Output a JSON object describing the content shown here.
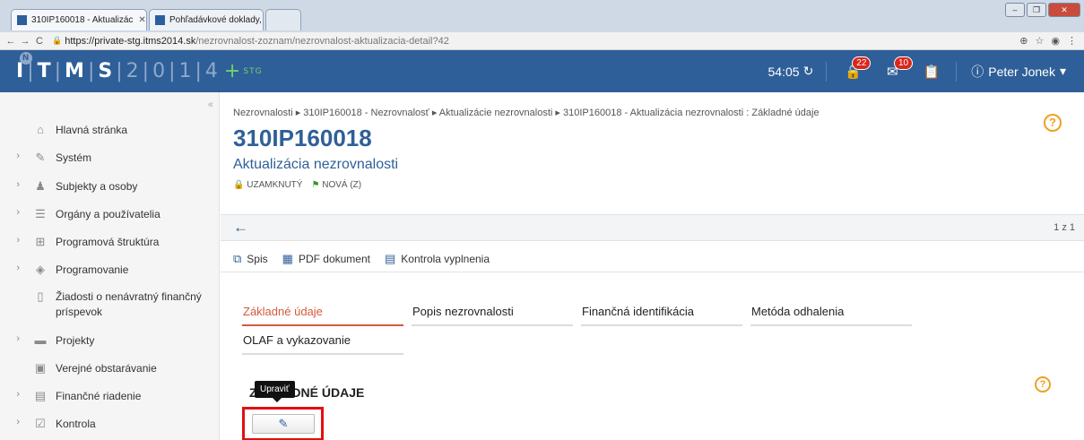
{
  "browser": {
    "tabs": [
      {
        "label": "310IP160018 - Aktualizác"
      },
      {
        "label": "Pohľadávkové doklady, I"
      }
    ],
    "url_host": "https://private-stg.itms2014.sk",
    "url_path": "/nezrovnalost-zoznam/nezrovnalost-aktualizacia-detail?42"
  },
  "header": {
    "logo": {
      "l1": "I",
      "l2": "T",
      "l3": "M",
      "l4": "S",
      "n1": "2",
      "n2": "0",
      "n3": "1",
      "n4": "4",
      "plus": "+",
      "env": "STG"
    },
    "timer": "54:05",
    "lock_badge": "22",
    "mail_badge": "10",
    "user": "Peter Jonek"
  },
  "sidebar": {
    "items": [
      {
        "label": "Hlavná stránka"
      },
      {
        "label": "Systém"
      },
      {
        "label": "Subjekty a osoby"
      },
      {
        "label": "Orgány a používatelia"
      },
      {
        "label": "Programová štruktúra"
      },
      {
        "label": "Programovanie"
      },
      {
        "label": "Žiadosti o nenávratný finančný príspevok"
      },
      {
        "label": "Projekty"
      },
      {
        "label": "Verejné obstarávanie"
      },
      {
        "label": "Finančné riadenie"
      },
      {
        "label": "Kontrola"
      }
    ]
  },
  "main": {
    "breadcrumb": "Nezrovnalosti ▸ 310IP160018 - Nezrovnalosť ▸ Aktualizácie nezrovnalosti ▸ 310IP160018 - Aktualizácia nezrovnalosti : Základné údaje",
    "title": "310IP160018",
    "subtitle": "Aktualizácia nezrovnalosti",
    "status_locked": "UZAMKNUTÝ",
    "status_new": "NOVÁ (Z)",
    "back": "←",
    "pager": "1 z 1",
    "toolbar": {
      "spis": "Spis",
      "pdf": "PDF dokument",
      "kontrola": "Kontrola vyplnenia"
    },
    "tabs": [
      {
        "label": "Základné údaje"
      },
      {
        "label": "Popis nezrovnalosti"
      },
      {
        "label": "Finančná identifikácia"
      },
      {
        "label": "Metóda odhalenia"
      },
      {
        "label": "OLAF a vykazovanie"
      }
    ],
    "section_title": "ZÁKLADNÉ ÚDAJE",
    "tooltip": "Upraviť",
    "help": "?"
  }
}
